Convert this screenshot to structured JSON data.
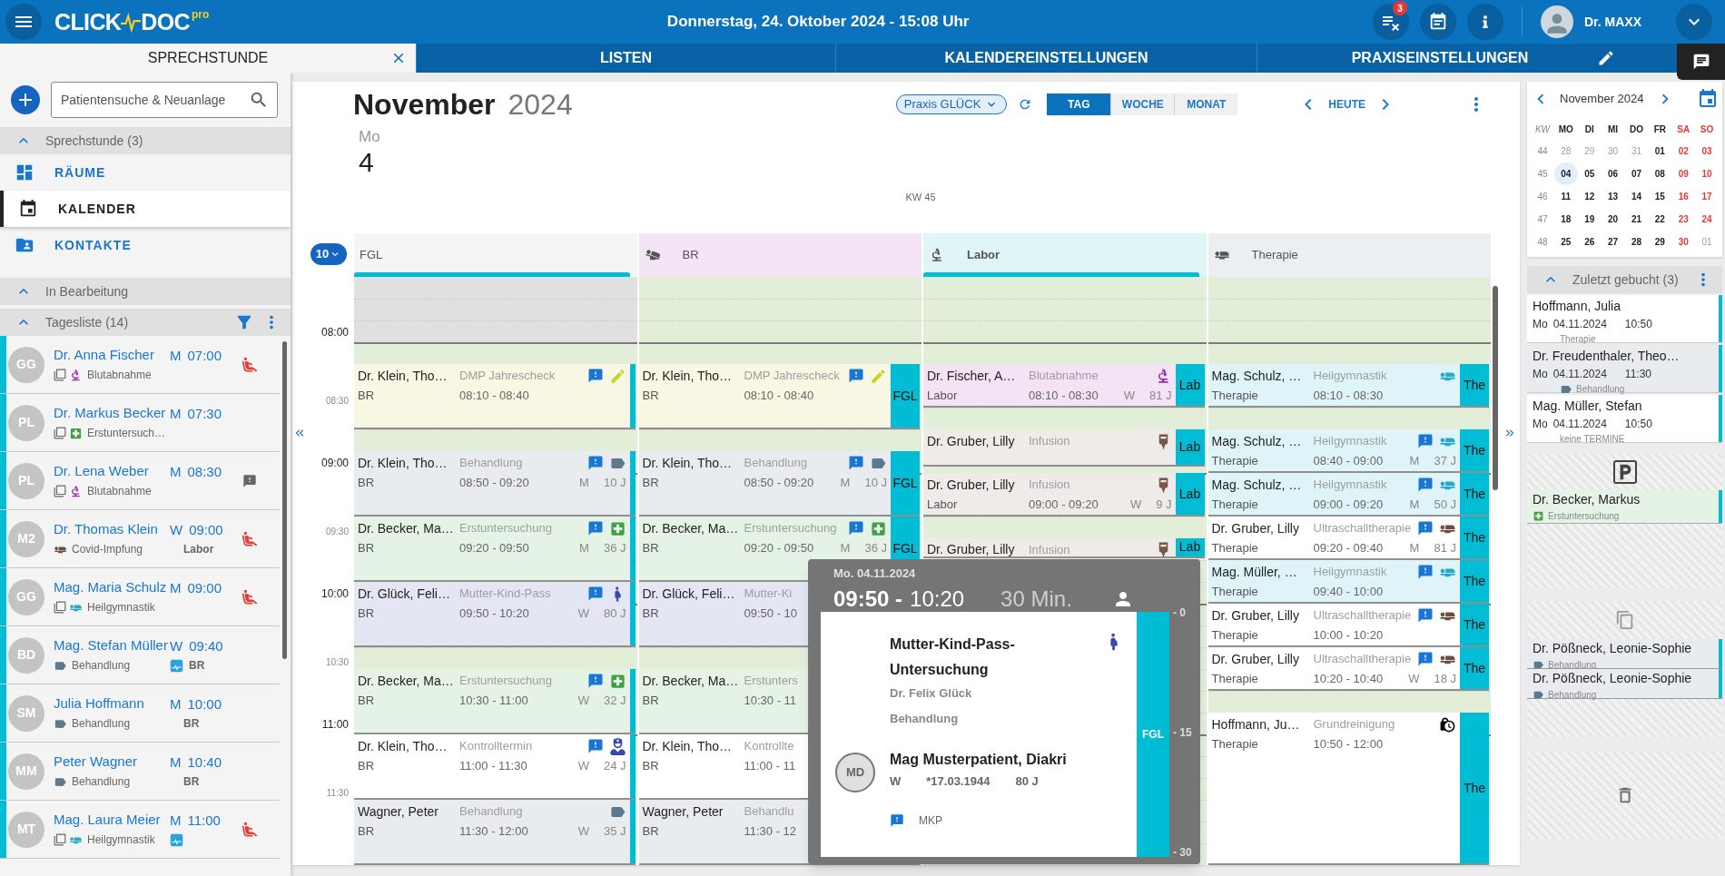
{
  "app": {
    "logo_left": "CLICK",
    "logo_right": "DOC",
    "logo_sup": "pro",
    "datetime": "Donnerstag, 24. Oktober 2024 - 15:08 Uhr",
    "notification_count": "3",
    "user": "Dr. MAXX"
  },
  "tabs": [
    {
      "label": "SPRECHSTUNDE",
      "selected": true,
      "closable": true,
      "editable": false
    },
    {
      "label": "LISTEN",
      "selected": false,
      "closable": false,
      "editable": false
    },
    {
      "label": "KALENDEREINSTELLUNGEN",
      "selected": false,
      "closable": false,
      "editable": false
    },
    {
      "label": "PRAXISEINSTELLUNGEN",
      "selected": false,
      "closable": false,
      "editable": true
    }
  ],
  "sidebar": {
    "search": {
      "placeholder": "Patientensuche & Neuanlage"
    },
    "section": {
      "title": "Sprechstunde (3)",
      "expanded": true
    },
    "nav": [
      {
        "label": "RÄUME",
        "kind": "rooms",
        "selected": false
      },
      {
        "label": "KALENDER",
        "kind": "calendar",
        "selected": true
      },
      {
        "label": "KONTAKTE",
        "kind": "contacts",
        "selected": false
      }
    ],
    "in_progress": {
      "title": "In Bearbeitung",
      "expanded": true
    },
    "day_list": {
      "title": "Tagesliste (14)",
      "expanded": true,
      "rows": [
        {
          "initials": "GG",
          "name": "Dr. Anna Fischer",
          "sex": "M",
          "time": "07:00",
          "linked": true,
          "kind": "blood",
          "type": "Blutabnahme",
          "card": false,
          "waiting": true,
          "comment": false
        },
        {
          "initials": "PL",
          "name": "Dr. Markus Becker",
          "sex": "M",
          "time": "07:30",
          "linked": true,
          "kind": "exam",
          "type": "Erstuntersuch…",
          "card": false,
          "waiting": false,
          "comment": false
        },
        {
          "initials": "PL",
          "name": "Dr. Lena Weber",
          "sex": "M",
          "time": "08:30",
          "linked": true,
          "kind": "blood",
          "type": "Blutabnahme",
          "card": false,
          "waiting": false,
          "comment": true
        },
        {
          "initials": "M2",
          "name": "Dr. Thomas Klein",
          "sex": "W",
          "time": "09:00",
          "linked": false,
          "kind": "vaccination",
          "type": "Covid-Impfung",
          "room": "Labor",
          "card": false,
          "waiting": true,
          "comment": false
        },
        {
          "initials": "GG",
          "name": "Mag. Maria Schulz",
          "sex": "M",
          "time": "09:00",
          "linked": true,
          "kind": "physio",
          "type": "Heilgymnastik",
          "card": false,
          "waiting": true,
          "comment": false
        },
        {
          "initials": "BD",
          "name": "Mag. Stefan Müller",
          "sex": "W",
          "time": "09:40",
          "linked": false,
          "kind": "treatment",
          "type": "Behandlung",
          "room": "BR",
          "card": true,
          "waiting": false,
          "comment": false
        },
        {
          "initials": "SM",
          "name": "Julia Hoffmann",
          "sex": "M",
          "time": "10:00",
          "linked": false,
          "kind": "treatment",
          "type": "Behandlung",
          "room": "BR",
          "card": false,
          "waiting": false,
          "comment": false
        },
        {
          "initials": "MM",
          "name": "Peter Wagner",
          "sex": "M",
          "time": "10:40",
          "linked": false,
          "kind": "treatment",
          "type": "Behandlung",
          "room": "BR",
          "card": false,
          "waiting": false,
          "comment": false
        },
        {
          "initials": "MT",
          "name": "Mag. Laura Meier",
          "sex": "M",
          "time": "11:00",
          "linked": true,
          "kind": "physio",
          "type": "Heilgymnastik",
          "card": true,
          "waiting": true,
          "comment": false
        }
      ]
    }
  },
  "calendar": {
    "month": "November",
    "year": "2024",
    "weekday": "Mo",
    "day": "4",
    "week": "KW 45",
    "practice": "Praxis GLÜCK",
    "views": [
      {
        "label": "TAG",
        "selected": true
      },
      {
        "label": "WOCHE",
        "selected": false
      },
      {
        "label": "MONAT",
        "selected": false
      }
    ],
    "today": "HEUTE",
    "zoom": "10",
    "times": [
      {
        "label": "08:00",
        "kind": "hour"
      },
      {
        "label": "08:30",
        "kind": "half"
      },
      {
        "label": "09:00",
        "kind": "hour"
      },
      {
        "label": "09:30",
        "kind": "half"
      },
      {
        "label": "10:00",
        "kind": "hour"
      },
      {
        "label": "10:30",
        "kind": "half"
      },
      {
        "label": "11:00",
        "kind": "hour"
      },
      {
        "label": "11:30",
        "kind": "half"
      }
    ],
    "columns": [
      {
        "title": "FGL",
        "kind": "none",
        "color": "#f5f5f5",
        "highlighted": true,
        "stripe": true,
        "events": [
          {
            "name": "Dr. Klein, Tho…",
            "type": "DMP Jahrescheck",
            "room": "BR",
            "time": "08:10 - 08:40",
            "kind": "dmp",
            "icon": true,
            "note": true
          },
          {
            "name": "Dr. Klein, Tho…",
            "type": "Behandlung",
            "room": "BR",
            "time": "08:50 - 09:20",
            "sex": "M",
            "age": "10 J",
            "kind": "treatment",
            "icon": true,
            "note": true
          },
          {
            "name": "Dr. Becker, Ma…",
            "type": "Erstuntersuchung",
            "room": "BR",
            "time": "09:20 - 09:50",
            "sex": "M",
            "age": "36 J",
            "kind": "exam",
            "icon": true,
            "note": true
          },
          {
            "name": "Dr. Glück, Feli…",
            "type": "Mutter-Kind-Pass",
            "room": "BR",
            "time": "09:50 - 10:20",
            "sex": "W",
            "age": "80 J",
            "kind": "maternity",
            "icon": true,
            "note": true
          },
          {
            "name": "Dr. Becker, Ma…",
            "type": "Erstuntersuchung",
            "room": "BR",
            "time": "10:30 - 11:00",
            "sex": "W",
            "age": "32 J",
            "kind": "exam",
            "icon": true,
            "note": true
          },
          {
            "name": "Dr. Klein, Tho…",
            "type": "Kontrolltermin",
            "room": "BR",
            "time": "11:00 - 11:30",
            "sex": "W",
            "age": "24 J",
            "kind": "checkup",
            "icon": true,
            "note": true
          },
          {
            "name": "Wagner, Peter",
            "type": "Behandlung",
            "room": "BR",
            "time": "11:30 - 12:00",
            "sex": "W",
            "age": "35 J",
            "kind": "treatment",
            "icon": true,
            "note": false
          }
        ]
      },
      {
        "title": "BR",
        "kind": "lying",
        "color": "#f3e5f5",
        "highlighted": false,
        "stripe": false,
        "events": [
          {
            "name": "Dr. Klein, Tho…",
            "type": "DMP Jahrescheck",
            "room": "BR",
            "time": "08:10 - 08:40",
            "kind": "dmp",
            "icon": true,
            "note": true,
            "tag": "FGL"
          },
          {
            "name": "Dr. Klein, Tho…",
            "type": "Behandlung",
            "room": "BR",
            "time": "08:50 - 09:20",
            "sex": "M",
            "age": "10 J",
            "kind": "treatment",
            "icon": true,
            "note": true,
            "tag": "FGL"
          },
          {
            "name": "Dr. Becker, Ma…",
            "type": "Erstuntersuchung",
            "room": "BR",
            "time": "09:20 - 09:50",
            "sex": "M",
            "age": "36 J",
            "kind": "exam",
            "icon": true,
            "note": true,
            "tag": "FGL"
          },
          {
            "name": "Dr. Glück, Feli…",
            "type": "Mutter-Ki",
            "room": "BR",
            "time": "09:50 - 10",
            "kind": "maternity",
            "icon": false,
            "note": false
          },
          {
            "name": "Dr. Becker, Ma…",
            "type": "Erstunters",
            "room": "BR",
            "time": "10:30 - 11",
            "kind": "exam",
            "icon": false,
            "note": false
          },
          {
            "name": "Dr. Klein, Tho…",
            "type": "Kontrollte",
            "room": "BR",
            "time": "11:00 - 11",
            "kind": "checkup",
            "icon": false,
            "note": false
          },
          {
            "name": "Wagner, Peter",
            "type": "Behandlu",
            "room": "BR",
            "time": "11:30 - 12",
            "kind": "treatment",
            "icon": false,
            "note": false
          }
        ]
      },
      {
        "title": "Labor",
        "kind": "microscope",
        "color": "#e0f5f8",
        "highlighted": true,
        "stripe": false,
        "events": [
          {
            "name": "Dr. Fischer, A…",
            "type": "Blutabnahme",
            "room": "Labor",
            "time": "08:10 - 08:30",
            "sex": "W",
            "age": "81 J",
            "kind": "blood",
            "icon": true,
            "note": false,
            "tag": "Lab"
          },
          {
            "name": "Dr. Gruber, Lilly",
            "type": "Infusion",
            "kind": "infusion",
            "icon": true,
            "note": false,
            "tag": "Lab"
          },
          {
            "name": "Dr. Gruber, Lilly",
            "type": "Infusion",
            "room": "Labor",
            "time": "09:00 - 09:20",
            "sex": "W",
            "age": "9 J",
            "kind": "infusion",
            "icon": true,
            "note": false,
            "tag": "Lab"
          },
          {
            "name": "Dr. Gruber, Lilly",
            "type": "Infusion",
            "kind": "infusion",
            "icon": true,
            "note": false,
            "tag": "Lab"
          }
        ]
      },
      {
        "title": "Therapie",
        "kind": "bed",
        "color": "#eceff1",
        "highlighted": false,
        "stripe": false,
        "events": [
          {
            "name": "Mag. Schulz, …",
            "type": "Heilgymnastik",
            "room": "Therapie",
            "time": "08:10 - 08:30",
            "kind": "physio",
            "icon": true,
            "note": false,
            "tag": "The"
          },
          {
            "name": "Mag. Schulz, …",
            "type": "Heilgymnastik",
            "room": "Therapie",
            "time": "08:40 - 09:00",
            "sex": "M",
            "age": "37 J",
            "kind": "physio",
            "icon": true,
            "note": true,
            "tag": "The"
          },
          {
            "name": "Mag. Schulz, …",
            "type": "Heilgymnastik",
            "room": "Therapie",
            "time": "09:00 - 09:20",
            "sex": "M",
            "age": "50 J",
            "kind": "physio",
            "icon": true,
            "note": true,
            "tag": "The"
          },
          {
            "name": "Dr. Gruber, Lilly",
            "type": "Ultraschalltherapie",
            "room": "Therapie",
            "time": "09:20 - 09:40",
            "sex": "M",
            "age": "81 J",
            "kind": "ultrasound",
            "icon": true,
            "note": true,
            "tag": "The"
          },
          {
            "name": "Mag. Müller, …",
            "type": "Heilgymnastik",
            "room": "Therapie",
            "time": "09:40 - 10:00",
            "kind": "physio",
            "icon": true,
            "note": true,
            "tag": "The"
          },
          {
            "name": "Dr. Gruber, Lilly",
            "type": "Ultraschalltherapie",
            "room": "Therapie",
            "time": "10:00 - 10:20",
            "kind": "ultrasound",
            "icon": true,
            "note": true,
            "tag": "The"
          },
          {
            "name": "Dr. Gruber, Lilly",
            "type": "Ultraschalltherapie",
            "room": "Therapie",
            "time": "10:20 - 10:40",
            "sex": "W",
            "age": "18 J",
            "kind": "ultrasound",
            "icon": true,
            "note": true,
            "tag": "The"
          },
          {
            "name": "Hoffmann, Ju…",
            "type": "Grundreinigung",
            "room": "Therapie",
            "time": "10:50 - 12:00",
            "kind": "cleaning",
            "icon": true,
            "note": false,
            "tag": "The"
          }
        ]
      }
    ],
    "popup": {
      "date": "Mo. 04.11.2024",
      "start": "09:50 -",
      "end": "10:20",
      "duration": "30 Min.",
      "title": "Mutter-Kind-Pass-Untersuchung",
      "kind": "maternity",
      "doctor": "Dr. Felix Glück",
      "type": "Behandlung",
      "initials": "MD",
      "patient": "Mag Musterpatient, Diakri",
      "sex": "W",
      "birth": "*17.03.1944",
      "age": "80 J",
      "note": true,
      "note_text": "MKP",
      "tag": "FGL",
      "scale": [
        "- 0",
        "- 15",
        "- 30"
      ]
    }
  },
  "right_panel": {
    "mini_calendar": {
      "month": "November 2024",
      "headers": [
        "KW",
        "MO",
        "DI",
        "MI",
        "DO",
        "FR",
        "SA",
        "SO"
      ],
      "weeks": [
        {
          "kw": "44",
          "days": [
            {
              "d": "28",
              "muted": true,
              "selected": false
            },
            {
              "d": "29",
              "muted": true,
              "selected": false
            },
            {
              "d": "30",
              "muted": true,
              "selected": false
            },
            {
              "d": "31",
              "muted": true,
              "selected": false
            },
            {
              "d": "01",
              "muted": false,
              "selected": false
            },
            {
              "d": "02",
              "muted": false,
              "selected": false
            },
            {
              "d": "03",
              "muted": false,
              "selected": false
            }
          ]
        },
        {
          "kw": "45",
          "days": [
            {
              "d": "04",
              "muted": false,
              "selected": true
            },
            {
              "d": "05",
              "muted": false,
              "selected": false
            },
            {
              "d": "06",
              "muted": false,
              "selected": false
            },
            {
              "d": "07",
              "muted": false,
              "selected": false
            },
            {
              "d": "08",
              "muted": false,
              "selected": false
            },
            {
              "d": "09",
              "muted": false,
              "selected": false
            },
            {
              "d": "10",
              "muted": false,
              "selected": false
            }
          ]
        },
        {
          "kw": "46",
          "days": [
            {
              "d": "11",
              "muted": false,
              "selected": false
            },
            {
              "d": "12",
              "muted": false,
              "selected": false
            },
            {
              "d": "13",
              "muted": false,
              "selected": false
            },
            {
              "d": "14",
              "muted": false,
              "selected": false
            },
            {
              "d": "15",
              "muted": false,
              "selected": false
            },
            {
              "d": "16",
              "muted": false,
              "selected": false
            },
            {
              "d": "17",
              "muted": false,
              "selected": false
            }
          ]
        },
        {
          "kw": "47",
          "days": [
            {
              "d": "18",
              "muted": false,
              "selected": false
            },
            {
              "d": "19",
              "muted": false,
              "selected": false
            },
            {
              "d": "20",
              "muted": false,
              "selected": false
            },
            {
              "d": "21",
              "muted": false,
              "selected": false
            },
            {
              "d": "22",
              "muted": false,
              "selected": false
            },
            {
              "d": "23",
              "muted": false,
              "selected": false
            },
            {
              "d": "24",
              "muted": false,
              "selected": false
            }
          ]
        },
        {
          "kw": "48",
          "days": [
            {
              "d": "25",
              "muted": false,
              "selected": false
            },
            {
              "d": "26",
              "muted": false,
              "selected": false
            },
            {
              "d": "27",
              "muted": false,
              "selected": false
            },
            {
              "d": "28",
              "muted": false,
              "selected": false
            },
            {
              "d": "29",
              "muted": false,
              "selected": false
            },
            {
              "d": "30",
              "muted": false,
              "selected": false
            },
            {
              "d": "01",
              "muted": true,
              "selected": false
            }
          ]
        }
      ]
    },
    "recent": {
      "title": "Zuletzt gebucht (3)",
      "expanded": true,
      "items": [
        {
          "name": "Hoffmann, Julia",
          "weekday": "Mo",
          "date": "04.11.2024",
          "time": "10:50",
          "kind": "plain",
          "type": "Therapie",
          "shaded": false
        },
        {
          "name": "Dr. Freudenthaler, Theo…",
          "weekday": "Mo",
          "date": "04.11.2024",
          "time": "11:30",
          "kind": "treatment",
          "type": "Behandlung",
          "shaded": true
        },
        {
          "name": "Mag. Müller, Stefan",
          "weekday": "Mo",
          "date": "04.11.2024",
          "time": "10:50",
          "kind": "plain",
          "type": "keine TERMINE",
          "shaded": false
        }
      ]
    },
    "parked": [
      {
        "name": "Dr. Becker, Markus",
        "kind": "exam",
        "type": "Erstuntersuchung"
      }
    ],
    "documents": [
      {
        "name": "Dr. Pößneck, Leonie-Sophie",
        "kind": "treatment",
        "type": "Behandlung"
      },
      {
        "name": "Dr. Pößneck, Leonie-Sophie",
        "kind": "treatment",
        "type": "Behandlung"
      }
    ]
  }
}
